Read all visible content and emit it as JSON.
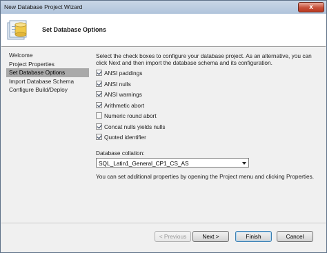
{
  "window": {
    "title": "New Database Project Wizard",
    "close_glyph": "x"
  },
  "header": {
    "title": "Set Database Options",
    "icon": "database-project-icon"
  },
  "nav": {
    "items": [
      {
        "label": "Welcome"
      },
      {
        "label": "Project Properties"
      },
      {
        "label": "Set Database Options",
        "selected": true
      },
      {
        "label": "Import Database Schema"
      },
      {
        "label": "Configure Build/Deploy"
      }
    ]
  },
  "content": {
    "description": "Select the check boxes to configure your database project. As an alternative, you can click Next and then import the database schema and its configuration.",
    "options": [
      {
        "label": "ANSI paddings",
        "checked": true
      },
      {
        "label": "ANSI nulls",
        "checked": true
      },
      {
        "label": "ANSI warnings",
        "checked": true
      },
      {
        "label": "Arithmetic abort",
        "checked": true
      },
      {
        "label": "Numeric round abort",
        "checked": false
      },
      {
        "label": "Concat nulls yields nulls",
        "checked": true
      },
      {
        "label": "Quoted identifier",
        "checked": true
      }
    ],
    "collation_label": "Database collation:",
    "collation_value": "SQL_Latin1_General_CP1_CS_AS",
    "note": "You can set additional properties by opening the Project menu and clicking Properties."
  },
  "buttons": {
    "previous": "< Previous",
    "next": "Next >",
    "finish": "Finish",
    "cancel": "Cancel"
  }
}
